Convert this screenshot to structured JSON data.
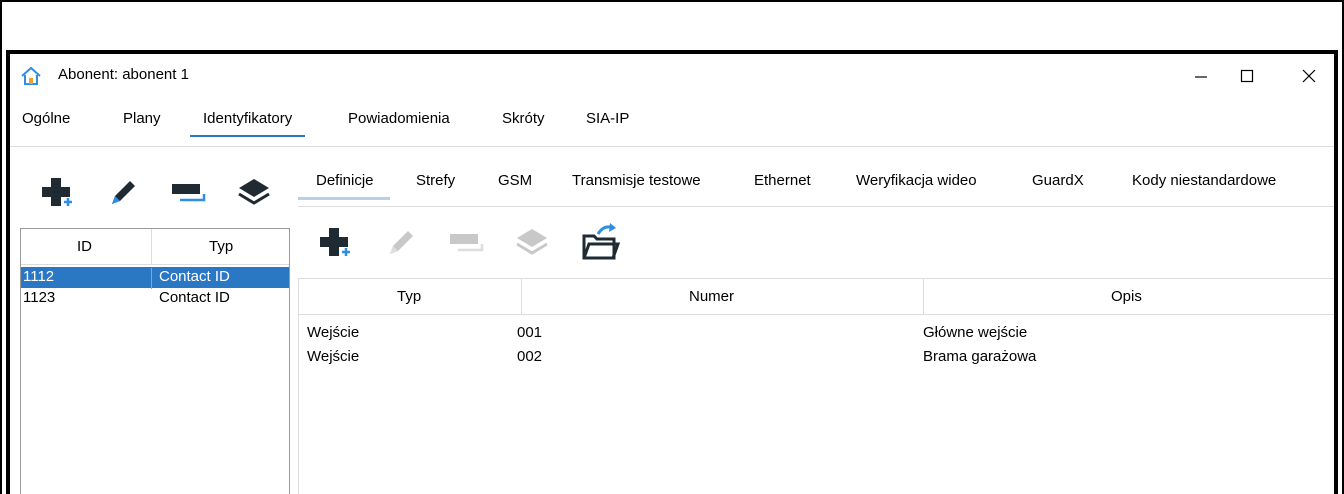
{
  "window": {
    "title": "Abonent: abonent 1",
    "icon": "home-icon",
    "controls": [
      "minimize-icon",
      "maximize-icon",
      "close-icon"
    ]
  },
  "main_tabs": [
    {
      "label": "Ogólne",
      "active": false
    },
    {
      "label": "Plany",
      "active": false
    },
    {
      "label": "Identyfikatory",
      "active": true
    },
    {
      "label": "Powiadomienia",
      "active": false
    },
    {
      "label": "Skróty",
      "active": false
    },
    {
      "label": "SIA-IP",
      "active": false
    }
  ],
  "left_toolbar": [
    "add-icon",
    "edit-icon",
    "delete-icon",
    "layers-icon"
  ],
  "left_table": {
    "columns": [
      "ID",
      "Typ"
    ],
    "rows": [
      {
        "id": "1112",
        "typ": "Contact ID",
        "selected": true
      },
      {
        "id": "1123",
        "typ": "Contact ID",
        "selected": false
      }
    ]
  },
  "sub_tabs": [
    {
      "label": "Definicje",
      "active": true
    },
    {
      "label": "Strefy",
      "active": false
    },
    {
      "label": "GSM",
      "active": false
    },
    {
      "label": "Transmisje testowe",
      "active": false
    },
    {
      "label": "Ethernet",
      "active": false
    },
    {
      "label": "Weryfikacja wideo",
      "active": false
    },
    {
      "label": "GuardX",
      "active": false
    },
    {
      "label": "Kody niestandardowe",
      "active": false
    }
  ],
  "right_toolbar": [
    "add-icon",
    "edit-icon-disabled",
    "delete-icon-disabled",
    "layers-icon-disabled",
    "open-folder-icon"
  ],
  "right_table": {
    "columns": [
      "Typ",
      "Numer",
      "Opis"
    ],
    "rows": [
      {
        "typ": "Wejście",
        "numer": "001",
        "opis": "Główne wejście"
      },
      {
        "typ": "Wejście",
        "numer": "002",
        "opis": "Brama garażowa"
      }
    ]
  },
  "colors": {
    "accent": "#2a78c4",
    "icon_dark": "#1f2a33",
    "icon_disabled": "#c8c8c8",
    "icon_blue": "#2f8de4"
  }
}
